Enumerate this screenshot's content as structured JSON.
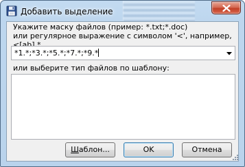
{
  "window": {
    "title": "Добавить выделение",
    "icon": "floppy-disk-icon"
  },
  "dialog": {
    "description_line1": "Укажите маску файлов (пример: *.txt;*.doc)",
    "description_line2": "или регулярное выражение с символом '<', например, <[ab].*",
    "mask_value": "*1.*;*3.*;*5.*;*7.*;*9.*",
    "template_label": "или выберите тип файлов по шаблону:",
    "template_items": []
  },
  "buttons": {
    "template_label_pre": "",
    "template_label_ul": "Ш",
    "template_label_post": "аблон...",
    "ok_label": "OK",
    "cancel_label": "Отмена"
  },
  "colors": {
    "title_bar": "#c3dbf1",
    "close_button": "#c24128",
    "client_bg": "#f0f0f0"
  }
}
